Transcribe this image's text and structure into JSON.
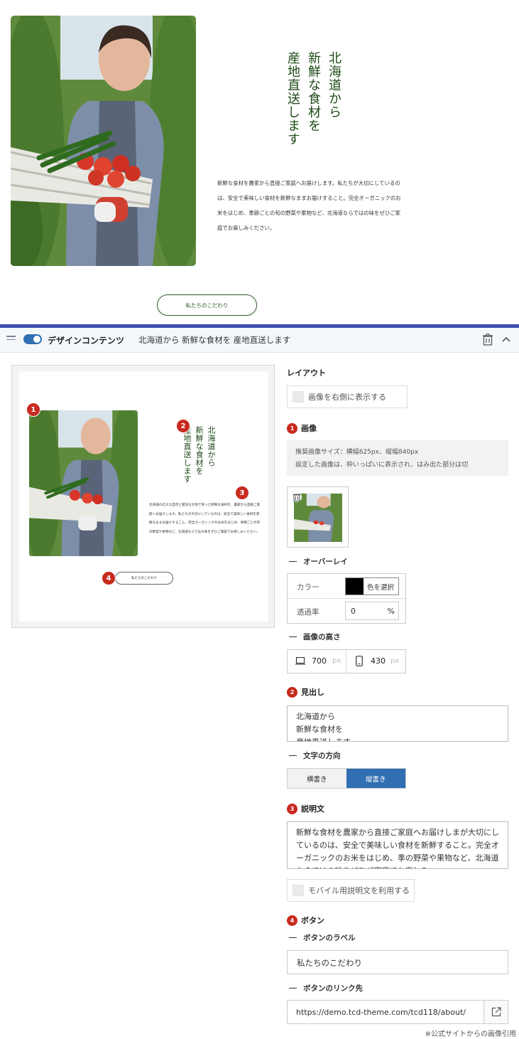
{
  "preview": {
    "heading": "北海道から\n新鮮な食材を\n産地直送します",
    "description": "新鮮な食材を農家から直接ご家庭へお届けします。私たちが大切にしているのは、安全で美味しい食材を新鮮なままお届けすること。完全オーガニックのお米をはじめ、季節ごとの旬の野菜や果物など、北海道ならではの味をぜひご家庭でお楽しみください。",
    "button_label": "私たちのこだわり"
  },
  "thumbnail": {
    "heading": "北海道から\n新鮮な食材を\n産地直送します",
    "description": "北海道の広大な自然と肥沃な大地で育った新鮮な食材を、農家から直接ご家庭へお届けします。私たちが大切にしているのは、安全で美味しい食材を新鮮なままお届けすること。完全オーガニックのお米をはじめ、季節ごとの旬の野菜や果物など、北海道ならではの味をぜひご家庭でお楽しみください。",
    "button_label": "私たちのこだわり",
    "markers": [
      "1",
      "2",
      "3",
      "4"
    ]
  },
  "block_header": {
    "name": "デザインコンテンツ",
    "summary": "北海道から 新鮮な食材を 産地直送します"
  },
  "panel": {
    "layout": {
      "title": "レイアウト",
      "image_right_label": "画像を右側に表示する"
    },
    "image": {
      "number": "1",
      "title": "画像",
      "note_line1": "推奨画像サイズ：横幅625px、縦幅840px",
      "note_line2": "設定した画像は、枠いっぱいに表示され、はみ出た部分は切"
    },
    "overlay": {
      "title": "オーバーレイ",
      "color_label": "カラー",
      "color_button": "色を選択",
      "color_value": "#000000",
      "opacity_label": "透過率",
      "opacity_value": "0",
      "opacity_unit": "%"
    },
    "image_height": {
      "title": "画像の高さ",
      "desktop_value": "700",
      "mobile_value": "430",
      "unit": "px"
    },
    "heading": {
      "number": "2",
      "title": "見出し",
      "value_line1": "北海道から",
      "value_line2": "新鮮な食材を",
      "value_line3": "産地直送します"
    },
    "text_direction": {
      "title": "文字の方向",
      "horizontal": "横書き",
      "vertical": "縦書き",
      "selected": "縦書き"
    },
    "description": {
      "number": "3",
      "title": "説明文",
      "value": "新鮮な食材を農家から直接ご家庭へお届けしまが大切にしているのは、安全で美味しい食材を新鮮すること。完全オーガニックのお米をはじめ、季の野菜や果物など、北海道ならではの味をぜひご家庭でお楽しみ",
      "mobile_label": "モバイル用説明文を利用する"
    },
    "button": {
      "number": "4",
      "title": "ボタン",
      "label_title": "ボタンのラベル",
      "label_value": "私たちのこだわり",
      "link_title": "ボタンのリンク先",
      "link_value": "https://demo.tcd-theme.com/tcd118/about/"
    }
  },
  "credit": "※公式サイトからの画像引用",
  "colors": {
    "accent_blue": "#2f6fb2",
    "marker_red": "#c92a1f",
    "heading_green": "#1c4a16"
  }
}
